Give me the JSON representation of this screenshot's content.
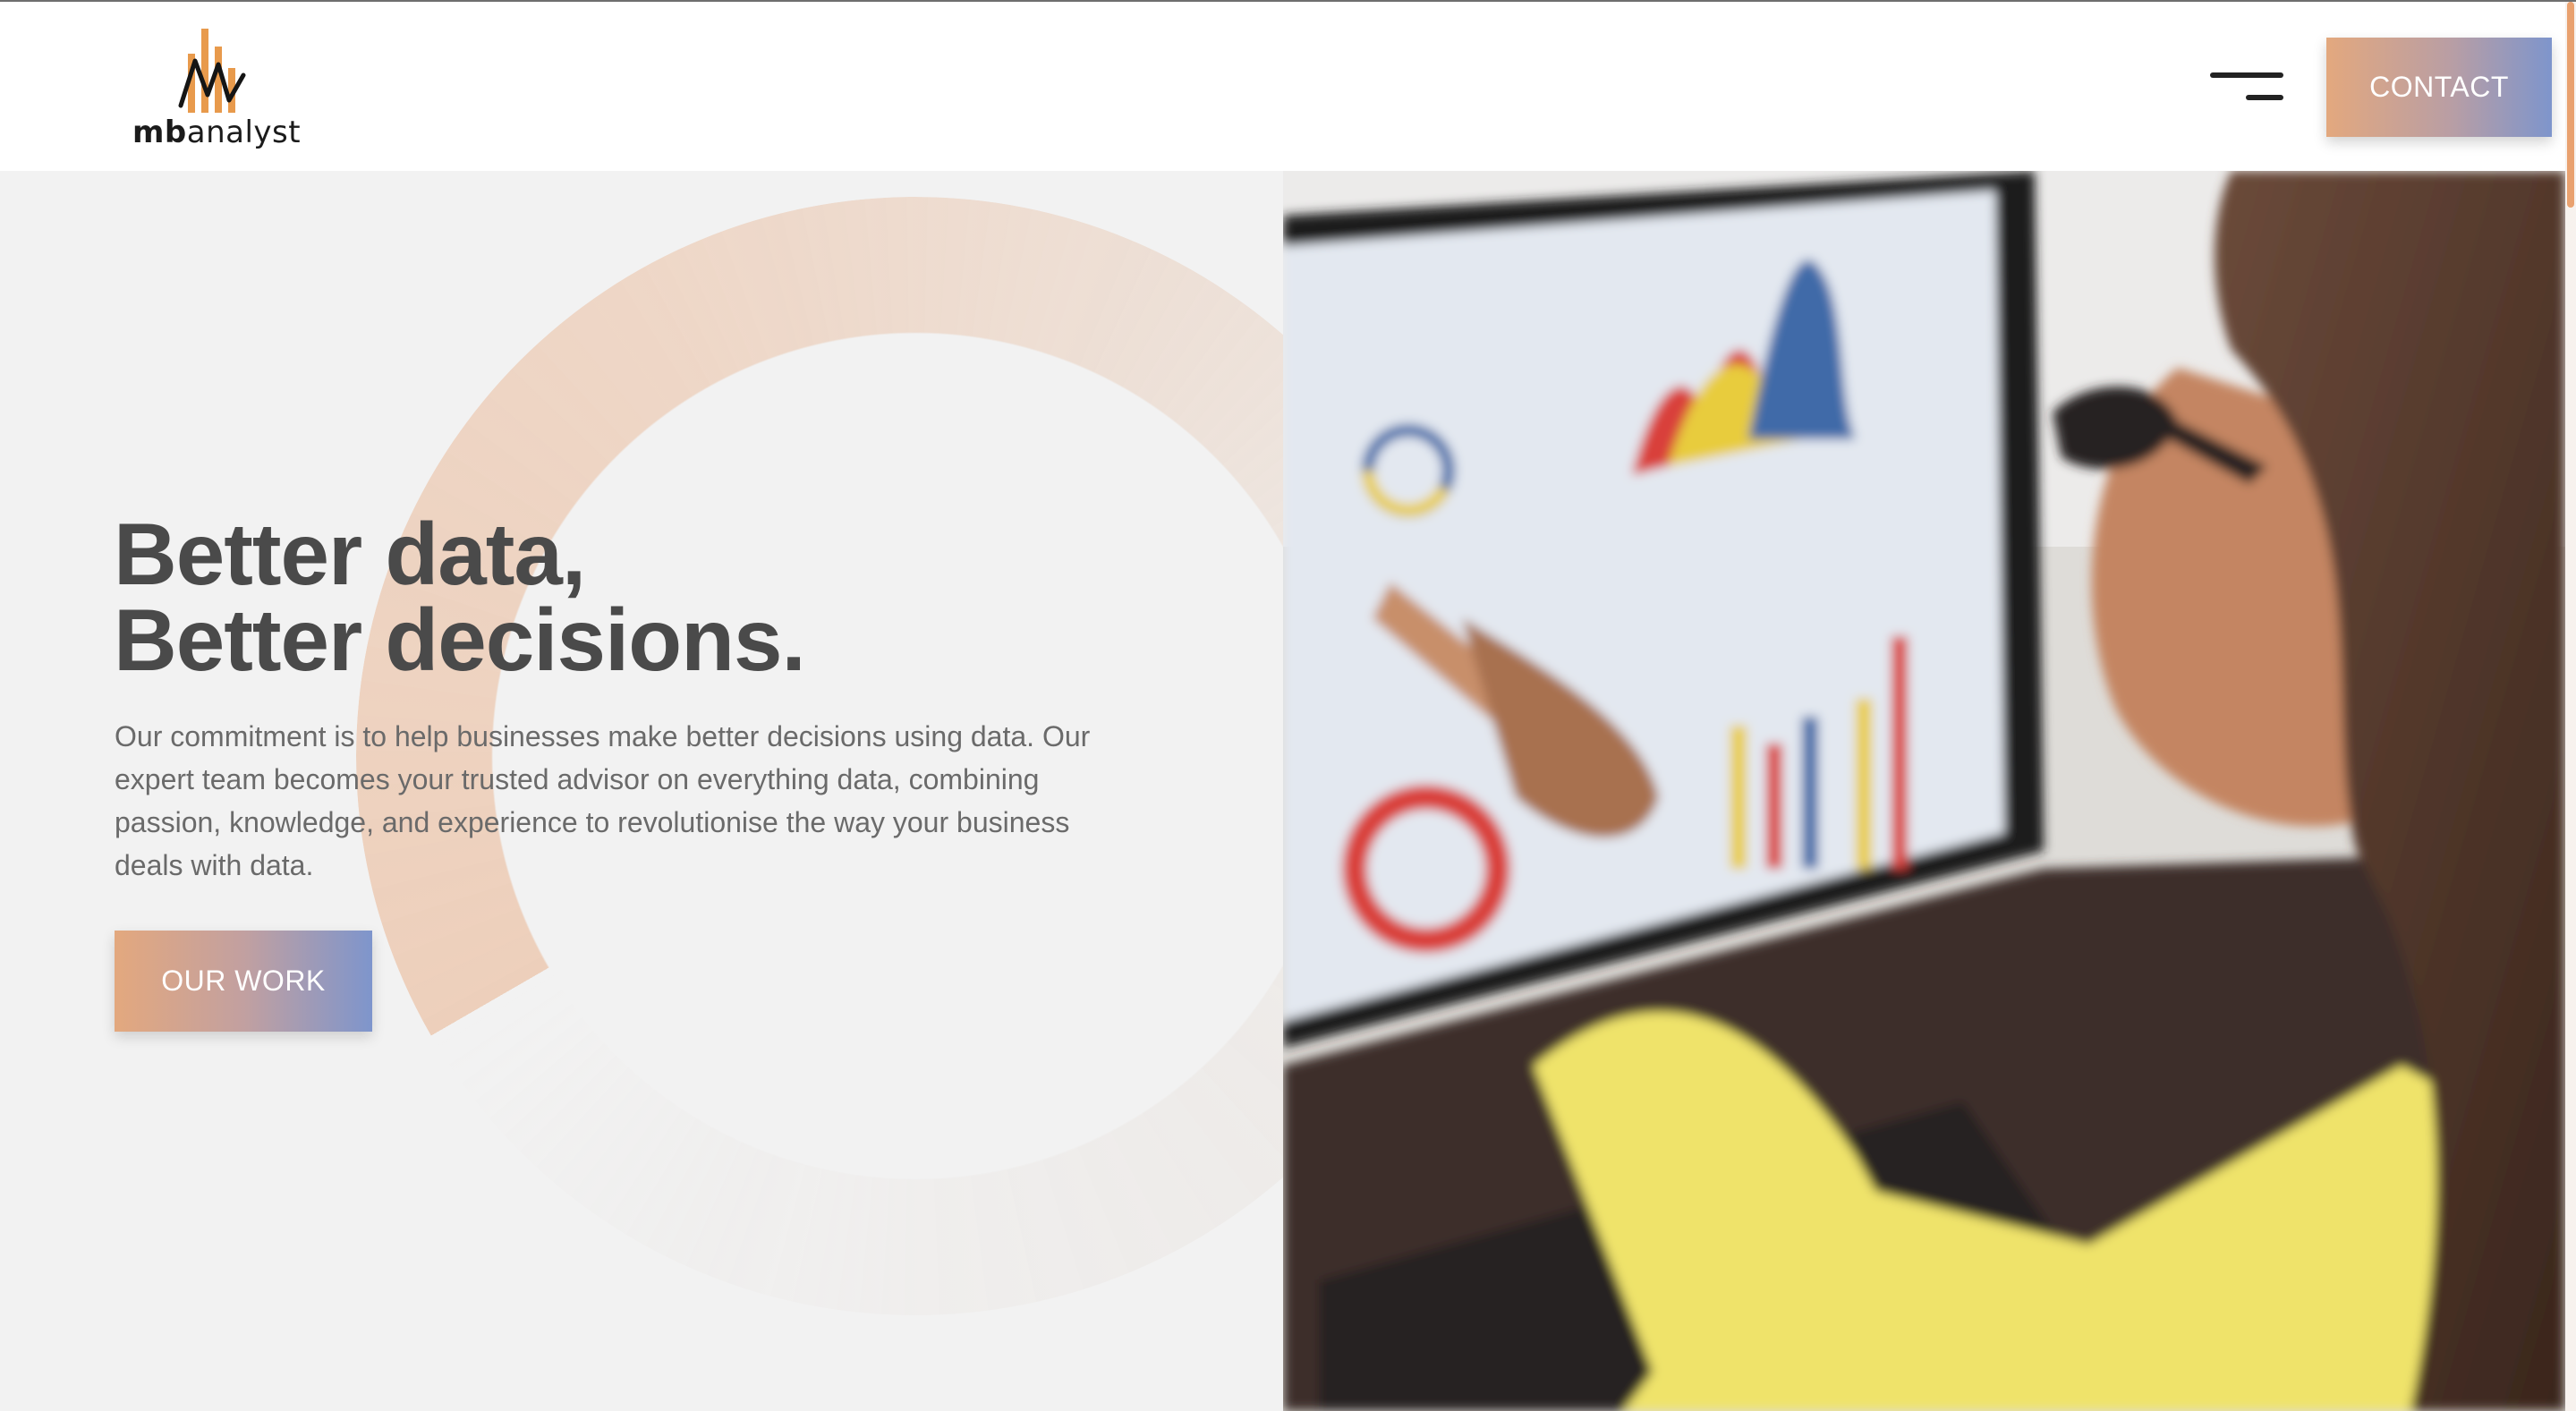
{
  "header": {
    "logo_bold": "mb",
    "logo_rest": "analyst",
    "contact_label": "CONTACT"
  },
  "hero": {
    "headline_line1": "Better data,",
    "headline_line2": "Better decisions.",
    "description": "Our commitment is to help businesses make better decisions using data. Our expert team becomes your trusted advisor on everything data, combining passion, knowledge, and experience to revolutionise the way your business deals with data.",
    "cta_label": "OUR WORK"
  },
  "icons": [
    "logo-mark-icon",
    "hamburger-menu-icon"
  ],
  "colors": {
    "accent_orange": "#e3a87e",
    "accent_blue": "#7e95cc",
    "text_dark": "#4a4a4a",
    "text_body": "#6a6a6a",
    "hero_bg": "#f2f2f2"
  }
}
